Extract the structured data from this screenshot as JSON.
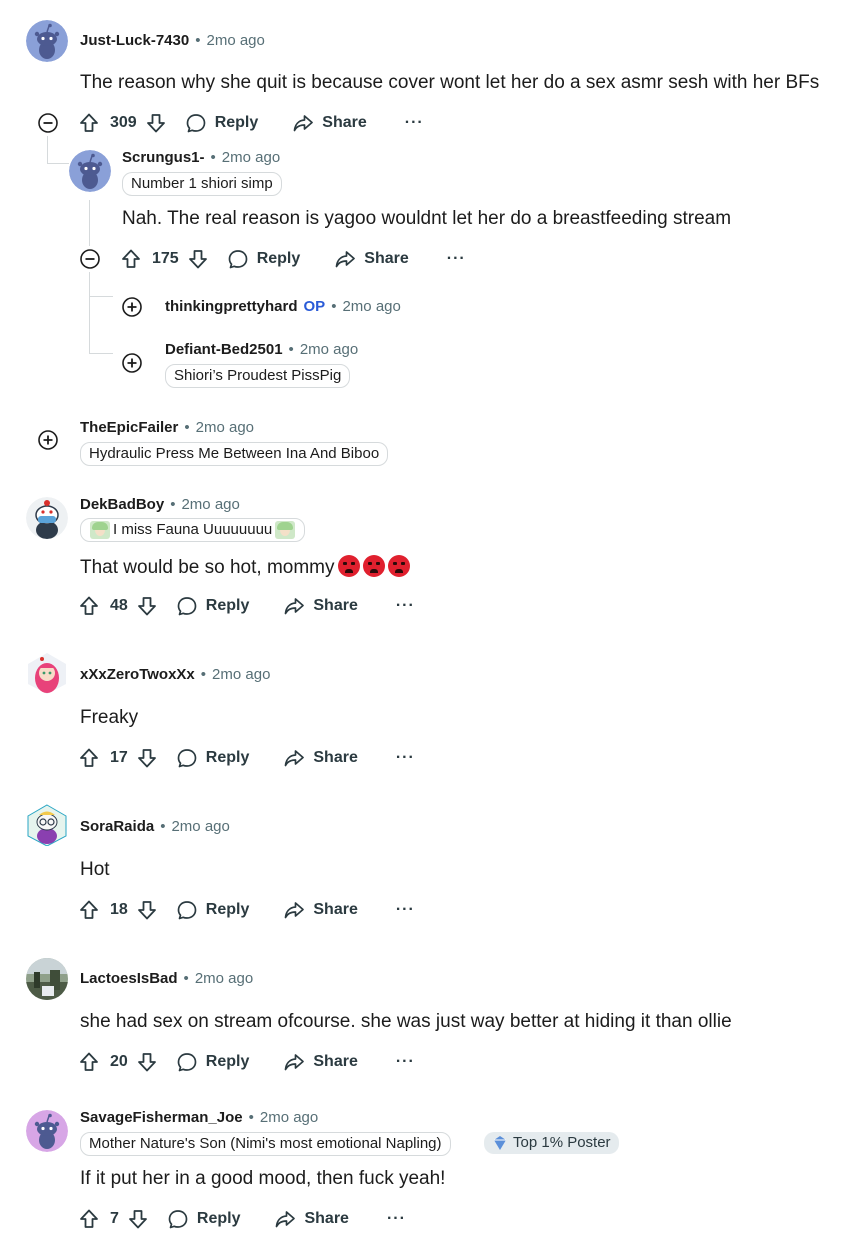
{
  "colors": {
    "text": "#1c1c1c",
    "muted": "#576f76",
    "op": "#2a5bd7",
    "thread_line": "#d6dadc"
  },
  "icons": {
    "upvote": "arrow-up-icon",
    "downvote": "arrow-down-icon",
    "reply": "speech-bubble-icon",
    "share": "share-arrow-icon",
    "more": "ellipsis-icon",
    "collapse": "minus-circle-icon",
    "expand": "plus-circle-icon"
  },
  "actions": {
    "reply_label": "Reply",
    "share_label": "Share",
    "more_label": "···"
  },
  "sep": "•",
  "comments": [
    {
      "username": "Just-Luck-7430",
      "time": "2mo ago",
      "body": "The reason why she quit is because cover wont let her do a sex asmr sesh with her BFs",
      "score": "309"
    },
    {
      "username": "Scrungus1-",
      "time": "2mo ago",
      "flair": "Number 1 shiori simp",
      "body": "Nah. The real reason is yagoo wouldnt let her do a breastfeeding stream",
      "score": "175"
    },
    {
      "username": "thinkingprettyhard",
      "op": "OP",
      "time": "2mo ago"
    },
    {
      "username": "Defiant-Bed2501",
      "time": "2mo ago",
      "flair": "Shiori’s Proudest PissPig"
    },
    {
      "username": "TheEpicFailer",
      "time": "2mo ago",
      "flair": "Hydraulic Press Me Between Ina And Biboo"
    },
    {
      "username": "DekBadBoy",
      "time": "2mo ago",
      "flair": "I miss Fauna Uuuuuuuu",
      "body": "That would be so hot, mommy",
      "score": "48"
    },
    {
      "username": "xXxZeroTwoxXx",
      "time": "2mo ago",
      "body": "Freaky",
      "score": "17"
    },
    {
      "username": "SoraRaida",
      "time": "2mo ago",
      "body": "Hot",
      "score": "18"
    },
    {
      "username": "LactoesIsBad",
      "time": "2mo ago",
      "body": "she had sex on stream ofcourse. she was just way better at hiding it than ollie",
      "score": "20"
    },
    {
      "username": "SavageFisherman_Joe",
      "time": "2mo ago",
      "flair": "Mother Nature's Son (Nimi's most emotional Napling)",
      "badge": "Top 1% Poster",
      "body": "If it put her in a good mood, then fuck yeah!",
      "score": "7"
    }
  ]
}
